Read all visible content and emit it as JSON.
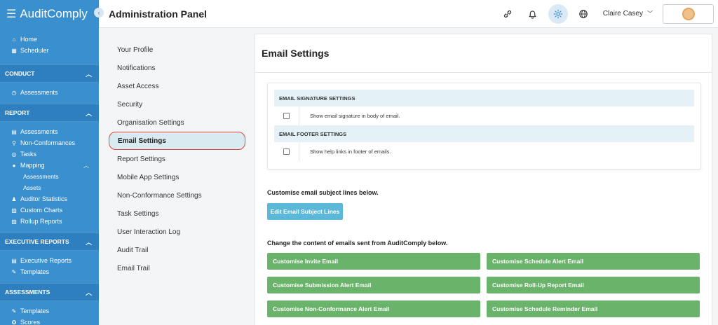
{
  "app": {
    "brand": "AuditComply"
  },
  "sidebar": {
    "top_items": [
      {
        "label": "Home"
      },
      {
        "label": "Scheduler"
      }
    ],
    "conduct": {
      "title": "CONDUCT",
      "items": [
        {
          "label": "Assessments"
        }
      ]
    },
    "report": {
      "title": "REPORT",
      "items": [
        {
          "label": "Assessments"
        },
        {
          "label": "Non-Conformances"
        },
        {
          "label": "Tasks"
        },
        {
          "label": "Mapping"
        },
        {
          "label": "Assessments"
        },
        {
          "label": "Assets"
        },
        {
          "label": "Auditor Statistics"
        },
        {
          "label": "Custom Charts"
        },
        {
          "label": "Rollup Reports"
        }
      ]
    },
    "executive": {
      "title": "EXECUTIVE REPORTS",
      "items": [
        {
          "label": "Executive Reports"
        },
        {
          "label": "Templates"
        }
      ]
    },
    "assessments": {
      "title": "ASSESSMENTS",
      "items": [
        {
          "label": "Templates"
        },
        {
          "label": "Scores"
        }
      ]
    }
  },
  "header": {
    "title": "Administration Panel",
    "user_name": "Claire Casey"
  },
  "menu": {
    "items": [
      {
        "label": "Your Profile"
      },
      {
        "label": "Notifications"
      },
      {
        "label": "Asset Access"
      },
      {
        "label": "Security"
      },
      {
        "label": "Organisation Settings"
      },
      {
        "label": "Email Settings"
      },
      {
        "label": "Report Settings"
      },
      {
        "label": "Mobile App Settings"
      },
      {
        "label": "Non-Conformance Settings"
      },
      {
        "label": "Task Settings"
      },
      {
        "label": "User Interaction Log"
      },
      {
        "label": "Audit Trail"
      },
      {
        "label": "Email Trail"
      }
    ],
    "active": "Email Settings"
  },
  "main": {
    "title": "Email Settings",
    "signature": {
      "heading": "EMAIL SIGNATURE SETTINGS",
      "option": "Show email signature in body of email.",
      "checked": false
    },
    "footer": {
      "heading": "EMAIL FOOTER SETTINGS",
      "option": "Show help links in footer of emails.",
      "checked": false
    },
    "subject_label": "Customise email subject lines below.",
    "subject_button": "Edit Email Subject Lines",
    "content_label": "Change the content of emails sent from AuditComply below.",
    "buttons": [
      "Customise Invite Email",
      "Customise Schedule Alert Email",
      "Customise Submission Alert Email",
      "Customise Roll-Up Report Email",
      "Customise Non-Conformance Alert Email",
      "Customise Schedule Reminder Email"
    ]
  },
  "colors": {
    "sidebar": "#3a8fcf",
    "accent_blue": "#5bb8d9",
    "accent_green": "#6ab36a",
    "active_outline": "#d9473a"
  }
}
